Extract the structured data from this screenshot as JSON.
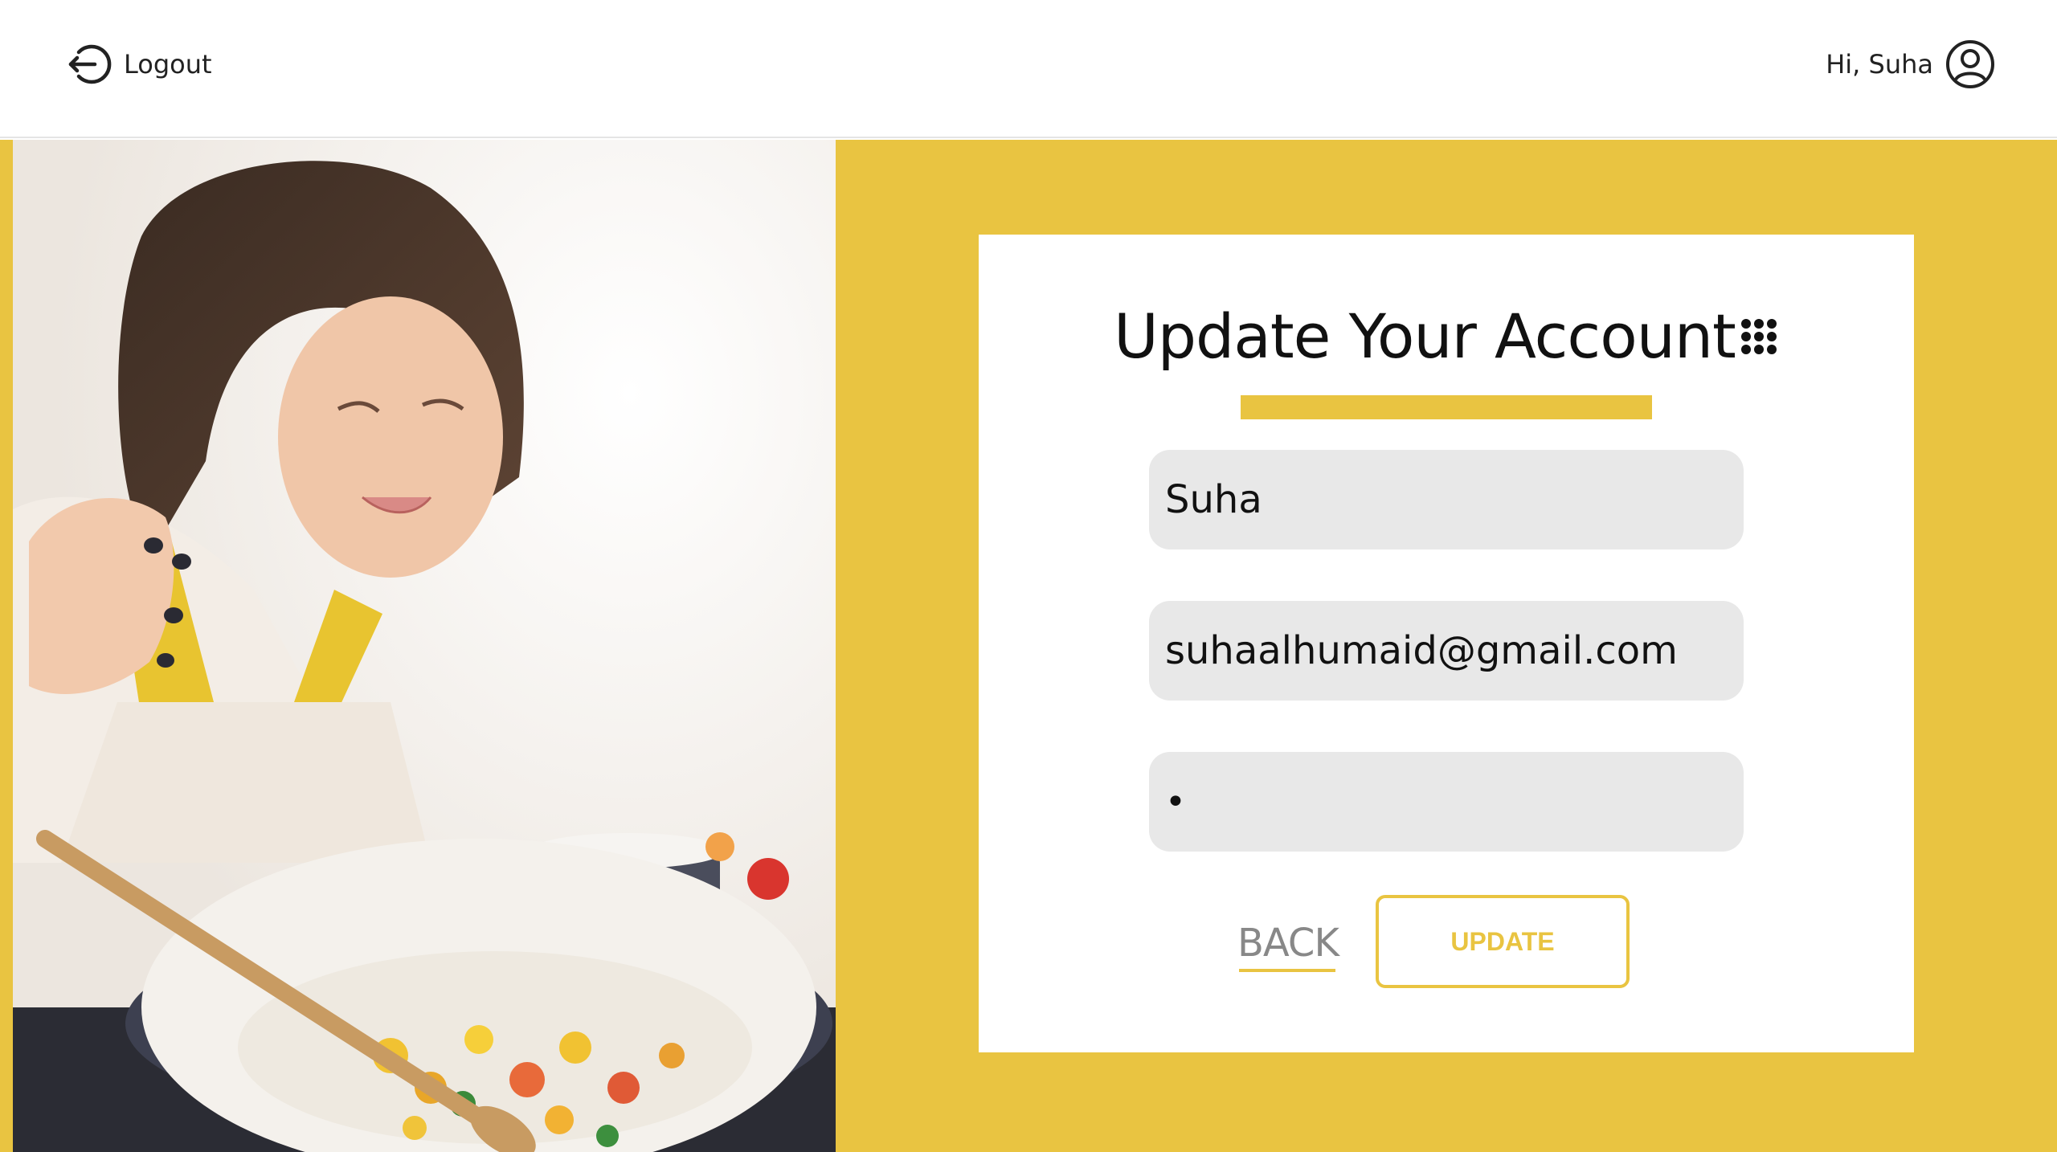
{
  "header": {
    "logout_label": "Logout",
    "greeting": "Hi, Suha",
    "logout_icon": "logout-icon",
    "user_icon": "user-circle-icon"
  },
  "hero": {
    "image": "woman-cooking-photo"
  },
  "form": {
    "title": "Update Your Account",
    "title_icon": "keypad-dots-icon",
    "name_value": "Suha",
    "email_value": "suhaalhumaid@gmail.com",
    "password_value": "•",
    "back_label": "BACK",
    "update_label": "UPDATE"
  },
  "colors": {
    "accent": "#e9c441",
    "field_bg": "#e8e8e8",
    "back_text": "#888888"
  }
}
